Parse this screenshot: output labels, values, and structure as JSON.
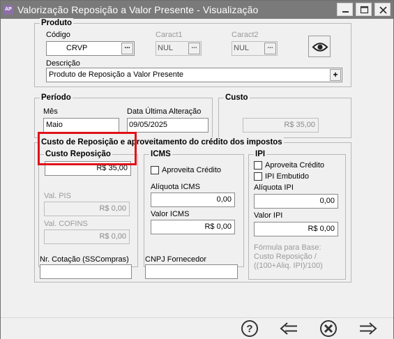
{
  "window": {
    "app_icon_text": "AP",
    "title": "Valorização Reposição a Valor Presente - Visualização"
  },
  "produto": {
    "legend": "Produto",
    "codigo_label": "Código",
    "codigo_value": "CRVP",
    "caract1_label": "Caract1",
    "caract1_value": "NUL",
    "caract2_label": "Caract2",
    "caract2_value": "NUL",
    "descricao_label": "Descrição",
    "descricao_value": "Produto de Reposição a Valor Presente",
    "lookup_dots": "...",
    "add_plus": "+"
  },
  "periodo": {
    "legend": "Período",
    "mes_label": "Mês",
    "mes_value": "Maio",
    "data_label": "Data Última Alteração",
    "data_value": "09/05/2025"
  },
  "custo": {
    "legend": "Custo",
    "value": "R$ 35,00"
  },
  "custo_reposicao": {
    "legend": "Custo de Reposição e aproveitamento do crédito dos impostos",
    "custo_reposicao_label": "Custo Reposição",
    "custo_reposicao_value": "R$ 35,00",
    "val_pis_label": "Val. PIS",
    "val_pis_value": "R$ 0,00",
    "val_cofins_label": "Val. COFINS",
    "val_cofins_value": "R$ 0,00",
    "nr_cotacao_label": "Nr. Cotação (SSCompras)",
    "nr_cotacao_value": "",
    "cnpj_label": "CNPJ Fornecedor",
    "cnpj_value": ""
  },
  "icms": {
    "legend": "ICMS",
    "aproveita_label": "Aproveita Crédito",
    "aproveita_checked": false,
    "aliquota_label": "Alíquota ICMS",
    "aliquota_value": "0,00",
    "valor_label": "Valor ICMS",
    "valor_value": "R$ 0,00"
  },
  "ipi": {
    "legend": "IPI",
    "aproveita_label": "Aproveita Crédito",
    "aproveita_checked": false,
    "embutido_label": "IPI Embutido",
    "embutido_checked": false,
    "aliquota_label": "Alíquota IPI",
    "aliquota_value": "0,00",
    "valor_label": "Valor IPI",
    "valor_value": "R$ 0,00",
    "formula_line1": "Fórmula para Base:",
    "formula_line2": "Custo Reposição /",
    "formula_line3": "((100+Aliq. IPI)/100)"
  },
  "toolbar": {
    "help_icon": "question-circle-icon",
    "back_icon": "arrow-left-icon",
    "cancel_icon": "x-circle-icon",
    "forward_icon": "arrow-right-icon"
  },
  "colors": {
    "titlebar": "#7a7a7a",
    "window_bg": "#f0f0f0",
    "highlight": "#e0121a",
    "disabled_text": "#9a9a9a"
  }
}
